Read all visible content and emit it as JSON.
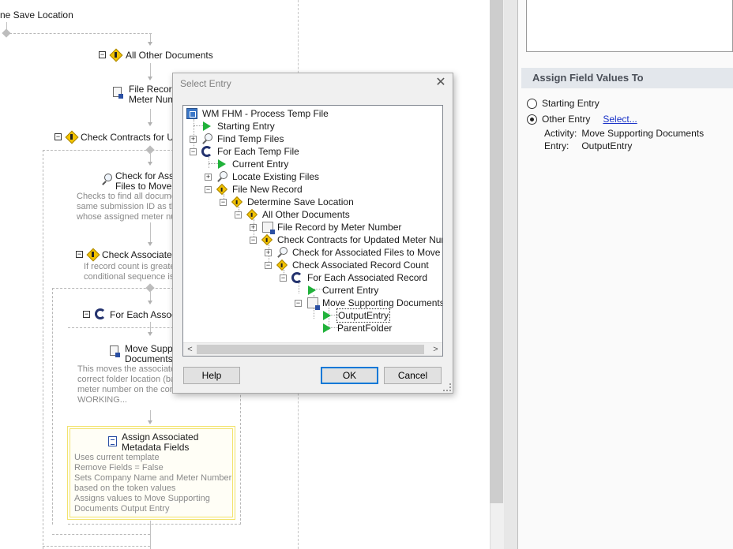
{
  "canvas": {
    "nodes": {
      "save_location": "ne Save Location",
      "all_other_documents": "All Other Documents",
      "file_record_line1": "File Record",
      "file_record_line2": "Meter Numb",
      "check_contracts": "Check Contracts for Upd",
      "check_assoc_files_line1": "Check for Assoc",
      "check_assoc_files_line2": "Files to Move",
      "check_assoc_files_desc": [
        "Checks to find all docume",
        "same submission ID as the",
        "whose assigned meter nur"
      ],
      "check_assoc_count": "Check Associated",
      "check_assoc_count_desc": [
        "If record count is greate",
        "conditional sequence is"
      ],
      "for_each_assoc": "For Each Associa",
      "move_supporting_line1": "Move Suppo",
      "move_supporting_line2": "Documents",
      "move_supporting_desc": [
        "This moves the associate",
        "correct folder location (ba",
        "meter number on the conti",
        "WORKING..."
      ],
      "assign_metadata_line1": "Assign Associated",
      "assign_metadata_line2": "Metadata Fields",
      "assign_metadata_desc": [
        "Uses current template",
        "Remove Fields = False",
        "Sets Company Name and Meter Number",
        "based on the token values",
        "Assigns values to Move Supporting",
        "Documents Output Entry"
      ]
    }
  },
  "right_panel": {
    "section_title": "Assign Field Values To",
    "option_starting": "Starting Entry",
    "option_other": "Other Entry",
    "select_link": "Select...",
    "activity_key": "Activity:",
    "activity_value": "Move Supporting Documents",
    "entry_key": "Entry:",
    "entry_value": "OutputEntry"
  },
  "dialog": {
    "title": "Select Entry",
    "close_glyph": "✕",
    "tree": [
      {
        "label": "WM FHM - Process Temp File",
        "icon": "process-icon"
      },
      {
        "label": "Starting Entry",
        "icon": "entry-icon"
      },
      {
        "label": "Find Temp Files",
        "icon": "search-icon"
      },
      {
        "label": "For Each Temp File",
        "icon": "loop-icon"
      },
      {
        "label": "Current Entry",
        "icon": "entry-icon"
      },
      {
        "label": "Locate Existing Files",
        "icon": "search-icon"
      },
      {
        "label": "File New Record",
        "icon": "decision-icon"
      },
      {
        "label": "Determine Save Location",
        "icon": "decision-icon"
      },
      {
        "label": "All Other Documents",
        "icon": "decision-icon"
      },
      {
        "label": "File Record by Meter Number",
        "icon": "document-icon"
      },
      {
        "label": "Check Contracts for Updated Meter Number",
        "icon": "decision-icon"
      },
      {
        "label": "Check for Associated Files to Move",
        "icon": "search-icon"
      },
      {
        "label": "Check Associated Record Count",
        "icon": "decision-icon"
      },
      {
        "label": "For Each Associated Record",
        "icon": "loop-icon"
      },
      {
        "label": "Current Entry",
        "icon": "entry-icon"
      },
      {
        "label": "Move Supporting Documents",
        "icon": "document-icon"
      },
      {
        "label": "OutputEntry",
        "icon": "entry-icon"
      },
      {
        "label": "ParentFolder",
        "icon": "entry-icon"
      }
    ],
    "hscroll_left": "<",
    "hscroll_right": ">",
    "help_label": "Help",
    "ok_label": "OK",
    "cancel_label": "Cancel"
  },
  "colors": {
    "entry_green": "#21b23b",
    "decision_yellow": "#f2c200",
    "loop_navy": "#23326e",
    "link_blue": "#1a33c7",
    "selected_box": "#f2e36e",
    "default_button_border": "#0078d7"
  }
}
